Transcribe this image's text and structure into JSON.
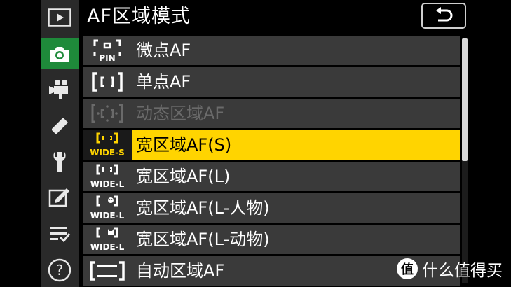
{
  "header": {
    "title": "AF区域模式"
  },
  "tabs": [
    {
      "name": "playback-tab",
      "icon": "play-icon",
      "active": false
    },
    {
      "name": "photo-shooting-tab",
      "icon": "camera-icon",
      "active": true
    },
    {
      "name": "movie-shooting-tab",
      "icon": "movie-camera-icon",
      "active": false
    },
    {
      "name": "custom-settings-tab",
      "icon": "pencil-icon",
      "active": false
    },
    {
      "name": "setup-tab",
      "icon": "wrench-icon",
      "active": false
    },
    {
      "name": "retouch-tab",
      "icon": "retouch-icon",
      "active": false
    },
    {
      "name": "my-menu-tab",
      "icon": "my-menu-icon",
      "active": false
    },
    {
      "name": "help-tab",
      "icon": "help-icon",
      "active": false
    }
  ],
  "menu": {
    "items": [
      {
        "icon": "pinpoint-af-icon",
        "icon_text": "PIN",
        "label": "微点AF",
        "state": "normal"
      },
      {
        "icon": "single-point-af-icon",
        "label": "单点AF",
        "state": "normal"
      },
      {
        "icon": "dynamic-area-af-icon",
        "label": "动态区域AF",
        "state": "disabled"
      },
      {
        "icon": "wide-area-s-icon",
        "icon_text": "WIDE-S",
        "label": "宽区域AF(S)",
        "state": "selected"
      },
      {
        "icon": "wide-area-l-icon",
        "icon_text": "WIDE-L",
        "label": "宽区域AF(L)",
        "state": "normal"
      },
      {
        "icon": "wide-area-l-people-icon",
        "icon_text": "WIDE-L",
        "label": "宽区域AF(L-人物)",
        "state": "normal"
      },
      {
        "icon": "wide-area-l-animals-icon",
        "icon_text": "WIDE-L",
        "label": "宽区域AF(L-动物)",
        "state": "normal"
      },
      {
        "icon": "auto-area-af-icon",
        "label": "自动区域AF",
        "state": "normal"
      }
    ]
  },
  "scrollbar": {
    "visible_fraction": 0.5,
    "position_fraction": 0
  },
  "watermark": {
    "text": "什么值得买",
    "logo_glyph": "值"
  },
  "colors": {
    "highlight": "#ffd400",
    "active_tab": "#1e8a3a",
    "row_bg": "#3a3a3a"
  }
}
